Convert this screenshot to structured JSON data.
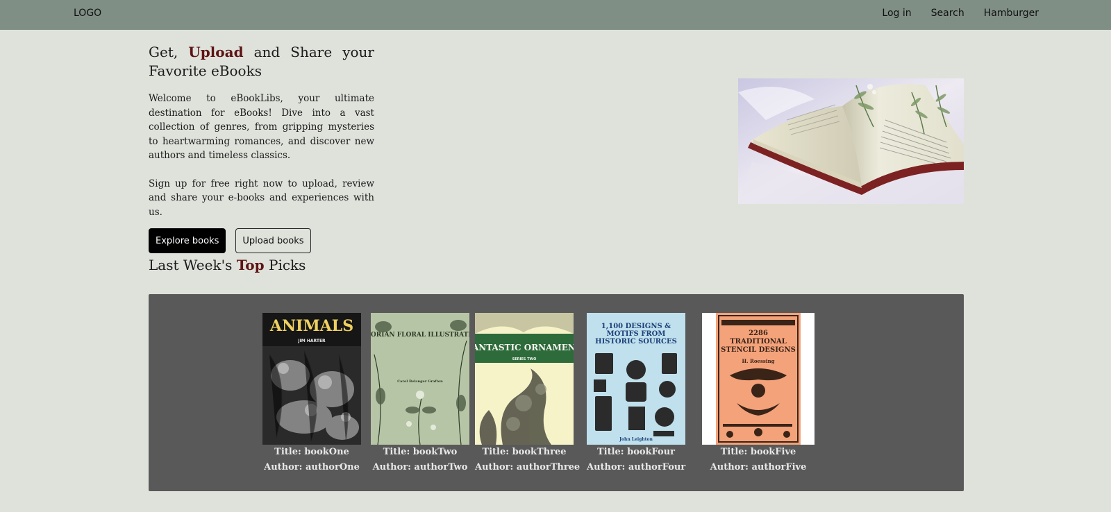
{
  "nav": {
    "logo": "LOGO",
    "links": [
      "Log in",
      "Search",
      "Hamburger"
    ]
  },
  "hero": {
    "title_pre": "Get, ",
    "title_strong": "Upload",
    "title_post": " and Share your Favorite eBooks",
    "paragraph1": "Welcome to eBookLibs, your ultimate destination for eBooks! Dive into a vast collection of genres, from gripping mysteries to heartwarming romances, and discover new authors and timeless classics.",
    "paragraph2": "Sign up for free right now to upload, review and share your e-books and experiences with us.",
    "explore_label": "Explore books",
    "upload_label": "Upload books"
  },
  "picks": {
    "title_pre": "Last Week's ",
    "title_strong": "Top",
    "title_post": " Picks",
    "books": [
      {
        "title": "Title: bookOne",
        "author": "Author: authorOne",
        "cover_text": "ANIMALS",
        "cover_sub": "JIM HARTER"
      },
      {
        "title": "Title: bookTwo",
        "author": "Author: authorTwo",
        "cover_text": "VICTORIAN FLORAL ILLUSTRATIONS",
        "cover_sub": "Carol Belanger Grafton"
      },
      {
        "title": "Title: bookThree",
        "author": "Author: authorThree",
        "cover_text": "FANTASTIC ORNAMENT",
        "cover_sub": "SERIES TWO"
      },
      {
        "title": "Title: bookFour",
        "author": "Author: authorFour",
        "cover_text": "1,100 DESIGNS & MOTIFS FROM HISTORIC SOURCES",
        "cover_sub": "John Leighton"
      },
      {
        "title": "Title: bookFive",
        "author": "Author: authorFive",
        "cover_text": "2286 TRADITIONAL STENCIL DESIGNS",
        "cover_sub": "H. Roessing"
      }
    ]
  },
  "colors": {
    "nav_bg": "#7f8f86",
    "page_bg": "#dfe2db",
    "accent": "#5e1414",
    "panel_bg": "#595959"
  }
}
